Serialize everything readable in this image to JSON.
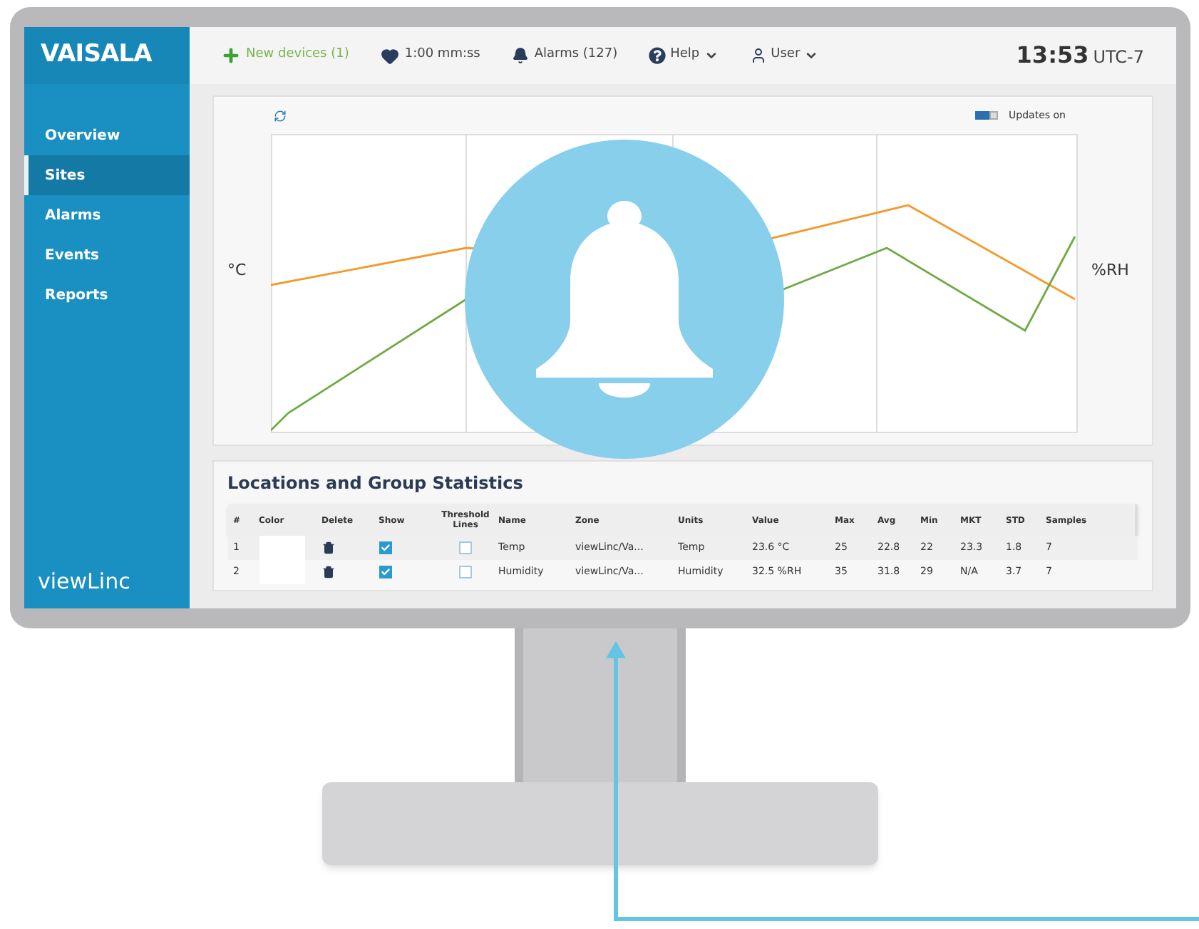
{
  "brand": "VAISALA",
  "topbar": {
    "new_devices": "New devices (1)",
    "timer": "1:00 mm:ss",
    "alarms": "Alarms (127)",
    "help": "Help",
    "user": "User",
    "time": "13:53",
    "timezone": "UTC-7"
  },
  "sidebar": {
    "items": [
      {
        "label": "Overview",
        "selected": false
      },
      {
        "label": "Sites",
        "selected": true
      },
      {
        "label": "Alarms",
        "selected": false
      },
      {
        "label": "Events",
        "selected": false
      },
      {
        "label": "Reports",
        "selected": false
      }
    ],
    "footer": "viewLinc"
  },
  "chart": {
    "updates_toggle": {
      "label": "Updates on",
      "on": true
    },
    "left_axis_label": "°C",
    "right_axis_label": "%RH"
  },
  "statistics": {
    "title": "Locations and Group Statistics",
    "columns": [
      "#",
      "Color",
      "Delete",
      "Show",
      "Threshold Lines",
      "Name",
      "Zone",
      "Units",
      "Value",
      "Max",
      "Avg",
      "Min",
      "MKT",
      "STD",
      "Samples"
    ],
    "rows": [
      {
        "number": "1",
        "show": true,
        "threshold_lines": false,
        "values": [
          "Temp",
          "viewLinc/Va...",
          "Temp",
          "23.6 °C",
          "25",
          "22.8",
          "22",
          "23.3",
          "1.8",
          "7"
        ]
      },
      {
        "number": "2",
        "show": true,
        "threshold_lines": false,
        "values": [
          "Humidity",
          "viewLinc/Va...",
          "Humidity",
          "32.5 %RH",
          "35",
          "31.8",
          "29",
          "N/A",
          "3.7",
          "7"
        ]
      }
    ]
  }
}
